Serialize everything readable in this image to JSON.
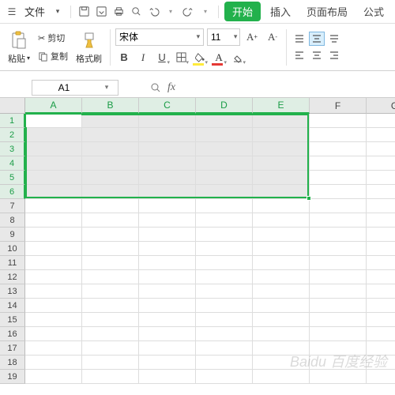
{
  "menu": {
    "file": "文件"
  },
  "tabs": {
    "start": "开始",
    "insert": "插入",
    "layout": "页面布局",
    "formula": "公式"
  },
  "ribbon": {
    "paste": "粘贴",
    "cut": "剪切",
    "copy": "复制",
    "format_painter": "格式刷",
    "font_name": "宋体",
    "font_size": "11"
  },
  "namebox": "A1",
  "columns": [
    "A",
    "B",
    "C",
    "D",
    "E",
    "F",
    "G"
  ],
  "sel_cols": 5,
  "sel_rows": 6,
  "total_rows": 19,
  "watermark": "Baidu 百度经验"
}
